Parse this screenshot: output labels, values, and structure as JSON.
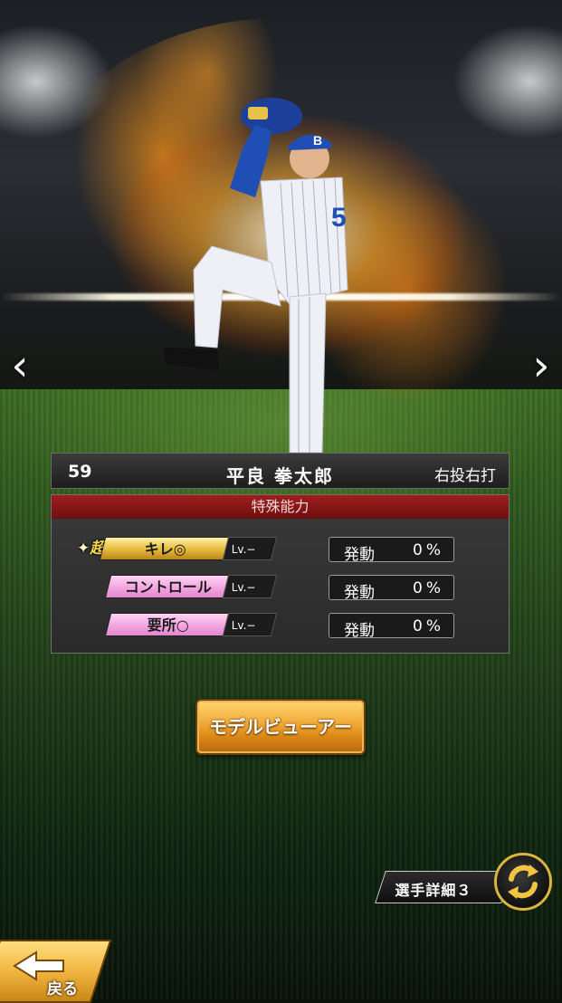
{
  "player": {
    "number": "59",
    "name": "平良 拳太郎",
    "handedness": "右投右打",
    "cap_letter": "B",
    "jersey_number": "5"
  },
  "abilities": {
    "header": "特殊能力",
    "super_badge": "超",
    "items": [
      {
        "name": "キレ◎",
        "level": "Lv.−",
        "trigger_label": "発動",
        "trigger_value": "0%",
        "color": "#e6b93a"
      },
      {
        "name": "コントロール",
        "level": "Lv.−",
        "trigger_label": "発動",
        "trigger_value": "0%",
        "color": "#f2a5df"
      },
      {
        "name": "要所○",
        "level": "Lv.−",
        "trigger_label": "発動",
        "trigger_value": "0%",
        "color": "#f2a5df"
      }
    ]
  },
  "buttons": {
    "model_viewer": "モデルビューアー",
    "player_detail": "選手詳細３",
    "back": "戻る"
  },
  "icons": {
    "prev": "chevron-left-icon",
    "next": "chevron-right-icon",
    "switch": "swap-arrows-icon",
    "back": "back-arrow-icon"
  },
  "colors": {
    "accent_gold": "#f0a834",
    "header_red": "#a01e1e",
    "uniform_blue": "#1f4fb4"
  }
}
